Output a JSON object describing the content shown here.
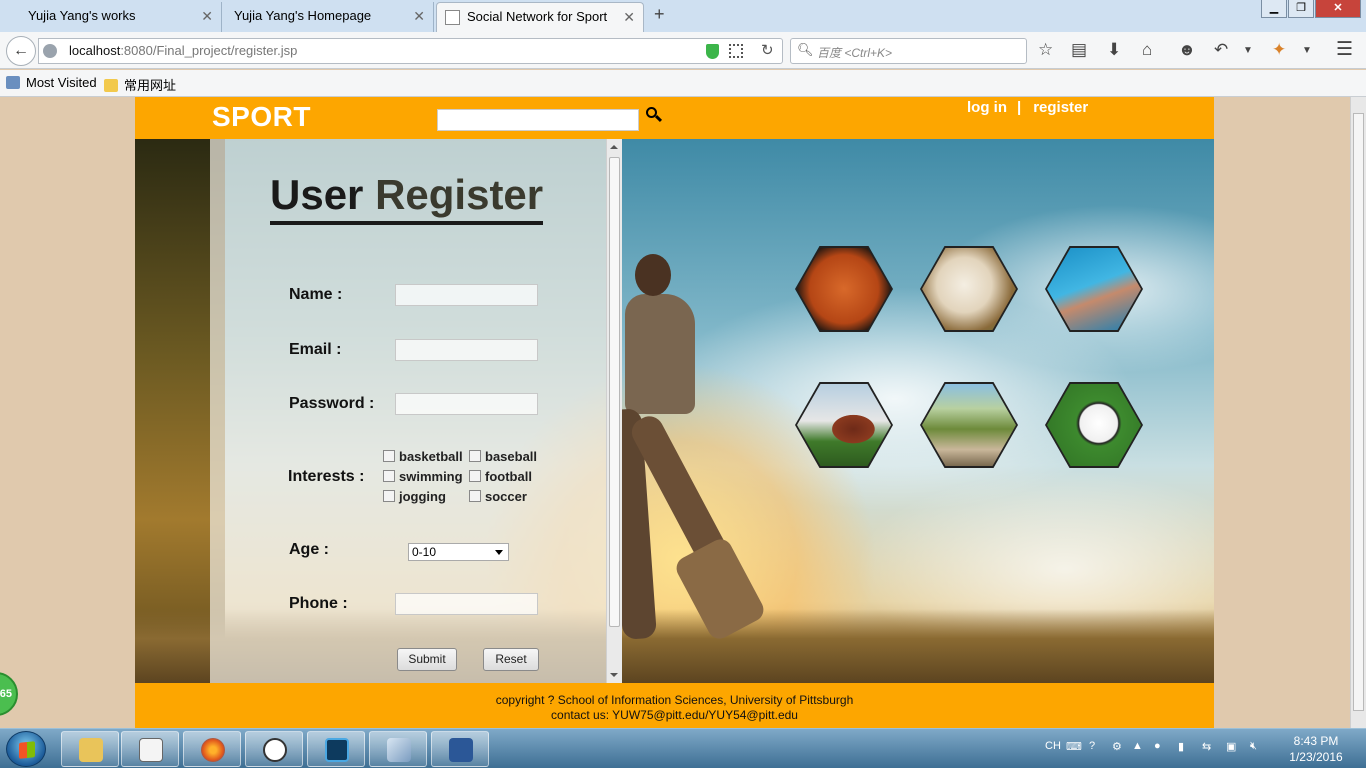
{
  "browser": {
    "tabs": [
      {
        "label": "Yujia Yang's works",
        "active": false
      },
      {
        "label": "Yujia Yang's Homepage",
        "active": false
      },
      {
        "label": "Social Network for Sport",
        "active": true
      }
    ],
    "url_host": "localhost",
    "url_rest": ":8080/Final_project/register.jsp",
    "search_placeholder": "百度 <Ctrl+K>",
    "bookmarks": [
      "Most Visited",
      "常用网址"
    ],
    "window_controls": {
      "close": "✕"
    }
  },
  "site": {
    "logo": "SPORT",
    "search_value": "",
    "login_link": "log in",
    "separator": "|",
    "register_link": "register"
  },
  "form": {
    "title_part1": "User",
    "title_part2": "Register",
    "name_label": "Name :",
    "email_label": "Email :",
    "password_label": "Password :",
    "interests_label": "Interests :",
    "interests": [
      "basketball",
      "baseball",
      "swimming",
      "football",
      "jogging",
      "soccer"
    ],
    "age_label": "Age :",
    "age_selected": "0-10",
    "phone_label": "Phone :",
    "submit_label": "Submit",
    "reset_label": "Reset"
  },
  "sports_icons": [
    "basketball-icon",
    "baseball-icon",
    "swimming-icon",
    "football-icon",
    "jogging-icon",
    "soccer-icon"
  ],
  "footer": {
    "copyright": "copyright ? School of Information Sciences, University of Pittsburgh",
    "contact": "contact us: YUW75@pitt.edu/YUY54@pitt.edu"
  },
  "side_badge": "65",
  "taskbar": {
    "lang": "CH",
    "time": "8:43 PM",
    "date": "1/23/2016"
  },
  "colors": {
    "accent": "#fda600",
    "page_background": "#e0c9ad"
  }
}
